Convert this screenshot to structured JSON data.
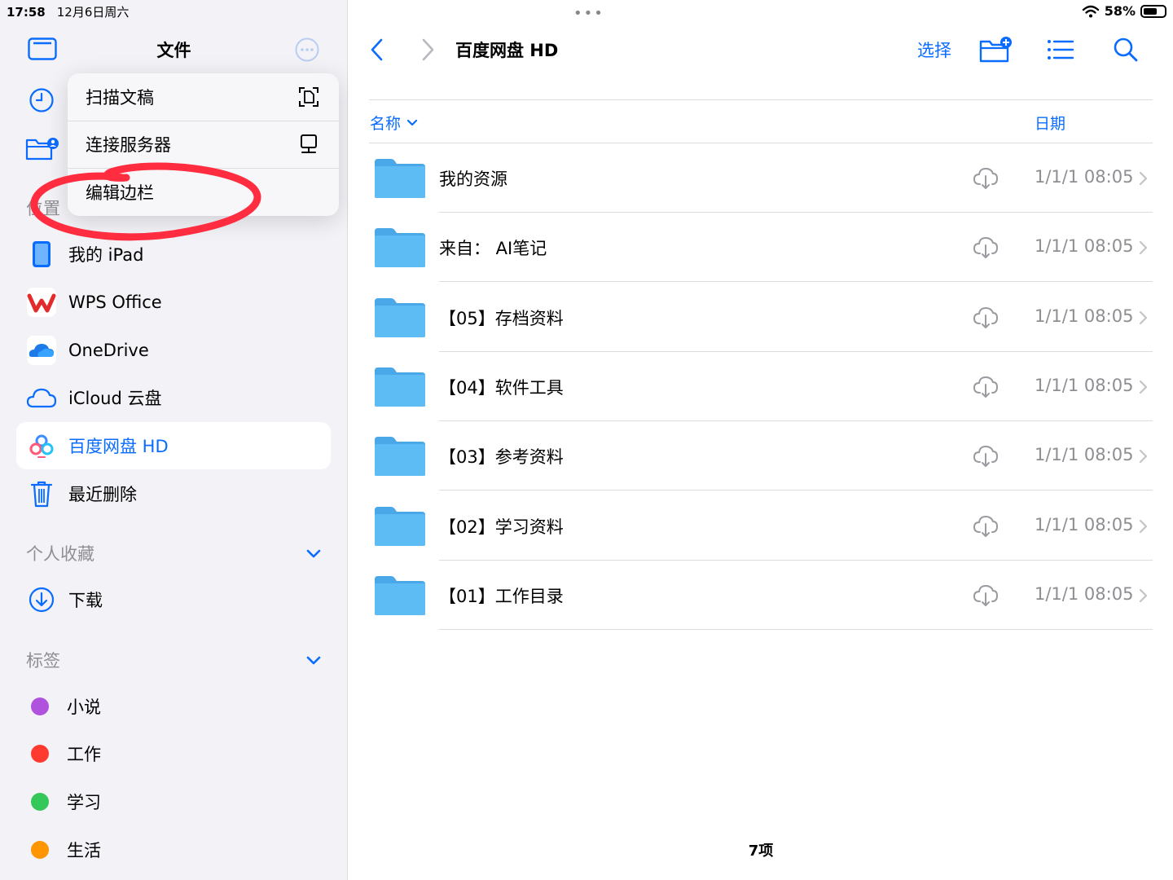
{
  "status": {
    "time": "17:58",
    "date": "12月6日周六",
    "battery": "58%"
  },
  "sidebar": {
    "title": "文件",
    "menu": [
      {
        "label": "扫描文稿",
        "icon": "scan-document-icon"
      },
      {
        "label": "连接服务器",
        "icon": "connect-server-icon"
      },
      {
        "label": "编辑边栏",
        "icon": ""
      }
    ],
    "locations_label": "位置",
    "locations": [
      {
        "label": "我的 iPad",
        "icon": "ipad-icon"
      },
      {
        "label": "WPS Office",
        "icon": "wps-icon"
      },
      {
        "label": "OneDrive",
        "icon": "onedrive-icon"
      },
      {
        "label": "iCloud 云盘",
        "icon": "icloud-icon"
      },
      {
        "label": "百度网盘 HD",
        "icon": "baidu-netdisk-icon",
        "selected": true
      },
      {
        "label": "最近删除",
        "icon": "trash-icon"
      }
    ],
    "favorites_label": "个人收藏",
    "favorites": [
      {
        "label": "下载",
        "icon": "download-icon"
      }
    ],
    "tags_label": "标签",
    "tags": [
      {
        "label": "小说",
        "color": "#af52de"
      },
      {
        "label": "工作",
        "color": "#ff3b30"
      },
      {
        "label": "学习",
        "color": "#34c759"
      },
      {
        "label": "生活",
        "color": "#ff9500"
      }
    ]
  },
  "main": {
    "title": "百度网盘 HD",
    "select_label": "选择",
    "columns": {
      "name": "名称",
      "date": "日期"
    },
    "files": [
      {
        "name": "我的资源",
        "date": "1/1/1 08:05"
      },
      {
        "name": "来自： AI笔记",
        "date": "1/1/1 08:05"
      },
      {
        "name": "【05】存档资料",
        "date": "1/1/1 08:05"
      },
      {
        "name": "【04】软件工具",
        "date": "1/1/1 08:05"
      },
      {
        "name": "【03】参考资料",
        "date": "1/1/1 08:05"
      },
      {
        "name": "【02】学习资料",
        "date": "1/1/1 08:05"
      },
      {
        "name": "【01】工作目录",
        "date": "1/1/1 08:05"
      }
    ],
    "item_count": "7项"
  },
  "colors": {
    "accent": "#0a6cff",
    "folder": "#5ab4ef",
    "annotation": "#ff2d3f"
  }
}
